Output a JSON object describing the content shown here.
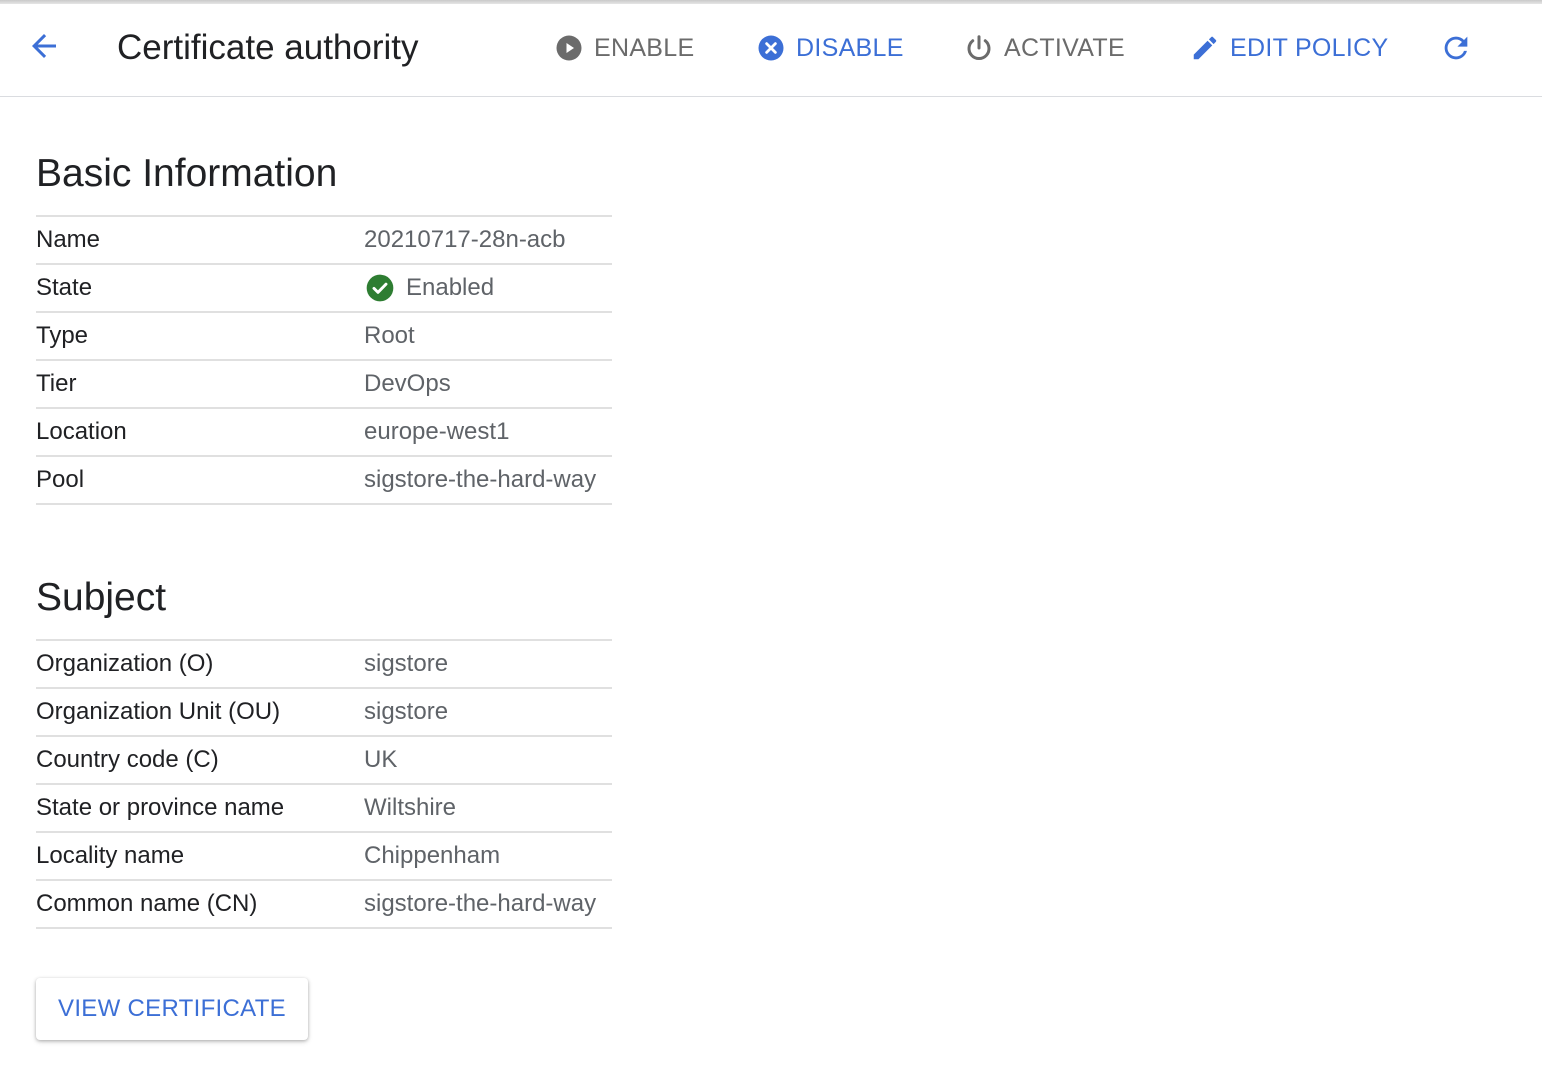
{
  "header": {
    "title": "Certificate authority",
    "actions": [
      {
        "label": "ENABLE",
        "icon": "play-circle-icon",
        "enabled": false
      },
      {
        "label": "DISABLE",
        "icon": "cancel-circle-icon",
        "enabled": true
      },
      {
        "label": "ACTIVATE",
        "icon": "power-icon",
        "enabled": false
      },
      {
        "label": "EDIT POLICY",
        "icon": "pencil-icon",
        "enabled": true
      }
    ],
    "back_icon": "arrow-back-icon",
    "refresh_icon": "refresh-icon"
  },
  "basic_info": {
    "heading": "Basic Information",
    "rows": [
      {
        "label": "Name",
        "value": "20210717-28n-acb"
      },
      {
        "label": "State",
        "value": "Enabled",
        "status_icon": "check-circle-icon"
      },
      {
        "label": "Type",
        "value": "Root"
      },
      {
        "label": "Tier",
        "value": "DevOps"
      },
      {
        "label": "Location",
        "value": "europe-west1"
      },
      {
        "label": "Pool",
        "value": "sigstore-the-hard-way"
      }
    ]
  },
  "subject": {
    "heading": "Subject",
    "rows": [
      {
        "label": "Organization (O)",
        "value": "sigstore"
      },
      {
        "label": "Organization Unit (OU)",
        "value": "sigstore"
      },
      {
        "label": "Country code (C)",
        "value": "UK"
      },
      {
        "label": "State or province name",
        "value": "Wiltshire"
      },
      {
        "label": "Locality name",
        "value": "Chippenham"
      },
      {
        "label": "Common name (CN)",
        "value": "sigstore-the-hard-way"
      }
    ]
  },
  "view_certificate_label": "VIEW CERTIFICATE",
  "colors": {
    "accent": "#3c6fd6",
    "disabled": "#6b6b6b",
    "success": "#2e7d32",
    "divider": "#e0e0e0"
  }
}
